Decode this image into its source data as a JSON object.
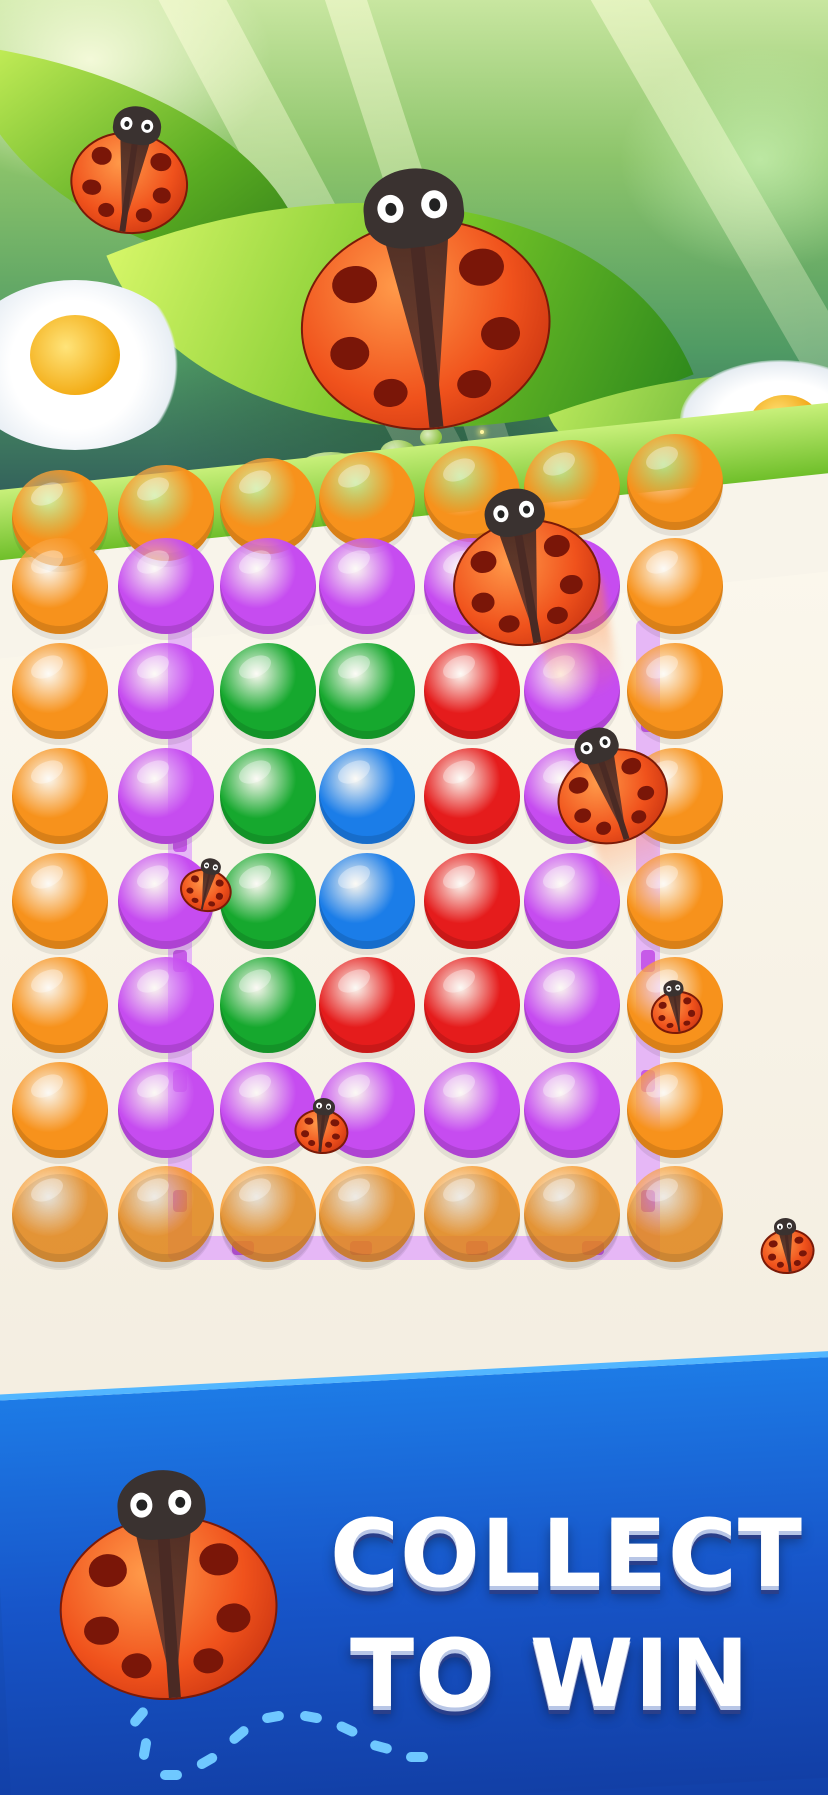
{
  "banner": {
    "headline_line1": "COLLECT",
    "headline_line2": "TO WIN"
  },
  "colors": {
    "orange": "#f7921c",
    "purple": "#c64cf0",
    "green": "#16a82e",
    "blue": "#1b7de8",
    "red": "#e51c1c",
    "banner_blue": "#1755c9",
    "leaf_green": "#6fbf2a"
  },
  "board": {
    "rows": [
      [
        "orange",
        "purple",
        "purple",
        "purple",
        "purple",
        "purple",
        "orange"
      ],
      [
        "orange",
        "purple",
        "green",
        "green",
        "red",
        "purple",
        "orange"
      ],
      [
        "orange",
        "purple",
        "green",
        "blue",
        "red",
        "purple",
        "orange"
      ],
      [
        "orange",
        "purple",
        "green",
        "blue",
        "red",
        "purple",
        "orange"
      ],
      [
        "orange",
        "purple",
        "green",
        "red",
        "red",
        "purple",
        "orange"
      ],
      [
        "orange",
        "purple",
        "purple",
        "purple",
        "purple",
        "purple",
        "orange"
      ],
      [
        "orange",
        "orange",
        "orange",
        "orange",
        "orange",
        "orange",
        "orange"
      ]
    ],
    "partial_top_row": [
      "orange",
      "orange",
      "orange",
      "orange",
      "orange",
      "orange",
      "orange"
    ],
    "connected_color": "purple",
    "connected_shape": "square-loop"
  },
  "icons": {
    "ladybug": "ladybug-icon",
    "daisy": "daisy-flower-icon",
    "leaf": "leaf-icon"
  }
}
